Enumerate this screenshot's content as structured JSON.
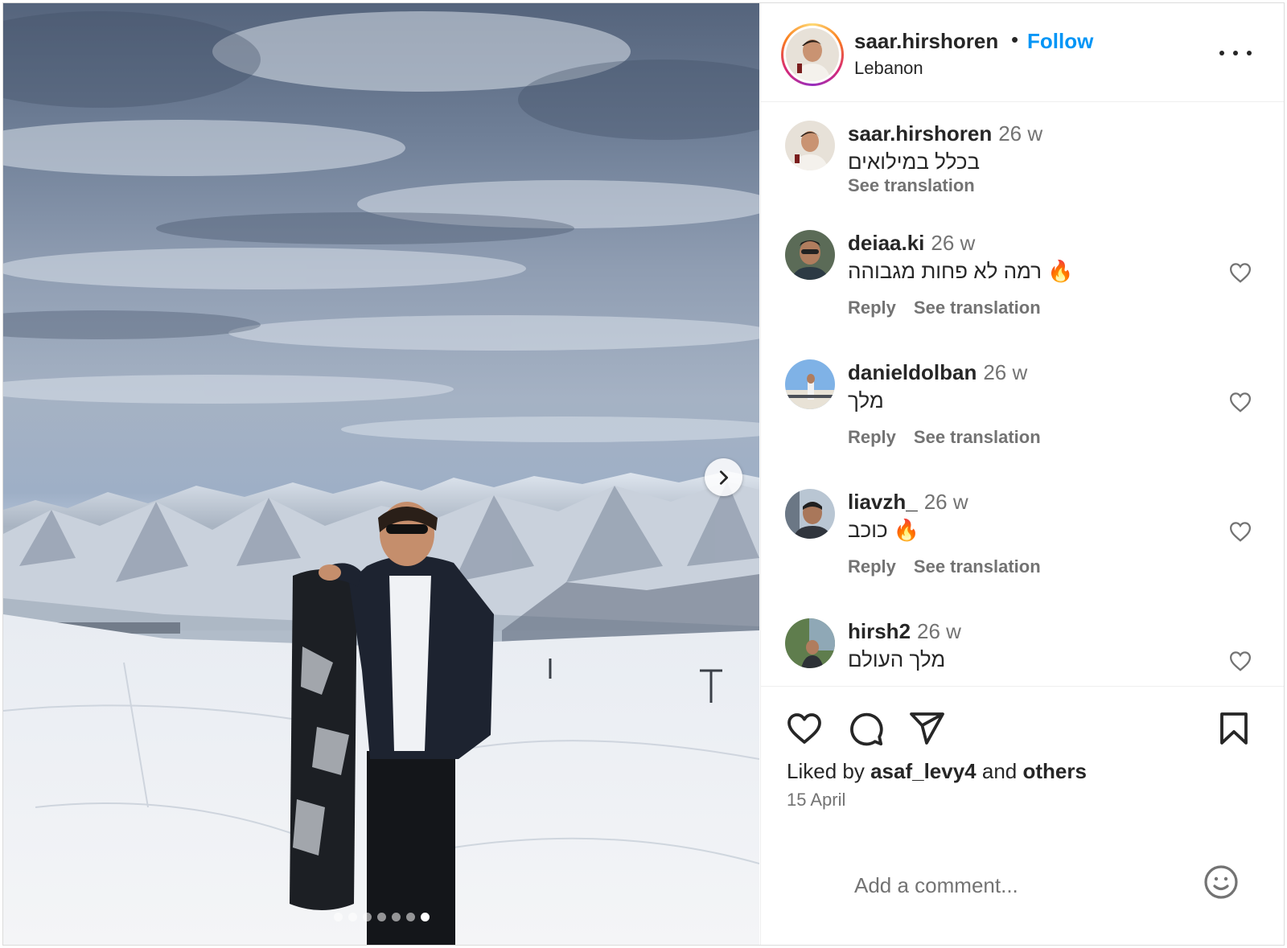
{
  "post": {
    "username": "saar.hirshoren",
    "separator": "•",
    "follow_label": "Follow",
    "location": "Lebanon",
    "carousel": {
      "count": 7,
      "active_index": 6,
      "next_icon": "chevron-right-icon"
    }
  },
  "comments": [
    {
      "username": "saar.hirshoren",
      "time": "26 w",
      "text": "בכלל במילואים",
      "see_translation": "See translation",
      "is_caption": true
    },
    {
      "username": "deiaa.ki",
      "time": "26 w",
      "text": "רמה לא פחות מגבוהה 🔥",
      "reply": "Reply",
      "see_translation": "See translation"
    },
    {
      "username": "danieldolban",
      "time": "26 w",
      "text": "מלך",
      "reply": "Reply",
      "see_translation": "See translation"
    },
    {
      "username": "liavzh_",
      "time": "26 w",
      "text": "כוכב 🔥",
      "reply": "Reply",
      "see_translation": "See translation"
    },
    {
      "username": "hirsh2",
      "time": "26 w",
      "text": "מלך העולם"
    }
  ],
  "likes": {
    "prefix": "Liked by",
    "user": "asaf_levy4",
    "joiner": "and",
    "others": "others"
  },
  "date": "15 April",
  "add_comment": {
    "placeholder": "Add a comment..."
  },
  "icons": [
    "heart-icon",
    "comment-icon",
    "share-icon",
    "bookmark-icon",
    "emoji-icon",
    "more-icon"
  ],
  "colors": {
    "link": "#0095f6",
    "text": "#262626",
    "secondary": "#737373",
    "border": "#dbdbdb"
  }
}
